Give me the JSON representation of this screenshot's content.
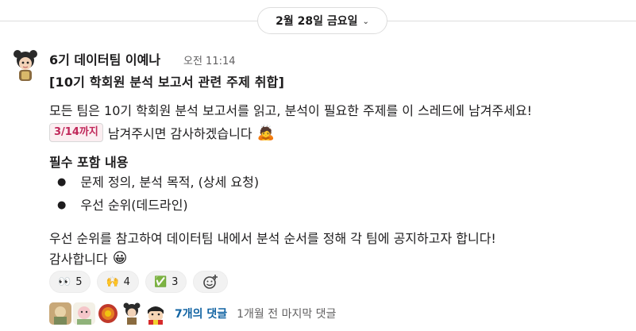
{
  "date_divider": {
    "label": "2월 28일 금요일",
    "chevron": "chevron-down-icon"
  },
  "message": {
    "author": "6기 데이터팀 이예나",
    "time": "오전 11:14",
    "title": "[10기 학회원 분석 보고서 관련 주제 취합]",
    "line1": "모든 팀은 10기 학회원 분석 보고서를 읽고, 분석이 필요한 주제를 이 스레드에 남겨주세요!",
    "deadline_chip": "3/14까지",
    "line2_rest": "남겨주시면 감사하겠습니다",
    "line2_emoji": "🙇",
    "section_heading": "필수 포함 내용",
    "bullets": [
      "문제 정의, 분석 목적, (상세 요청)",
      "우선 순위(데드라인)"
    ],
    "line3": "우선 순위를 참고하여 데이터팀 내에서 분석 순서를 정해 각 팀에 공지하고자 합니다!",
    "line4": "감사합니다",
    "line4_emoji": "😀"
  },
  "reactions": [
    {
      "emoji": "👀",
      "count": "5"
    },
    {
      "emoji": "🙌",
      "count": "4"
    },
    {
      "emoji": "✅",
      "count": "3"
    }
  ],
  "add_reaction_icon": "add-reaction-icon",
  "thread": {
    "reply_count": "7개의 댓글",
    "last_reply": "1개월 전 마지막 댓글"
  },
  "colors": {
    "link": "#1264a3",
    "chip_text": "#c0285a",
    "chip_bg": "#fbeef1"
  }
}
